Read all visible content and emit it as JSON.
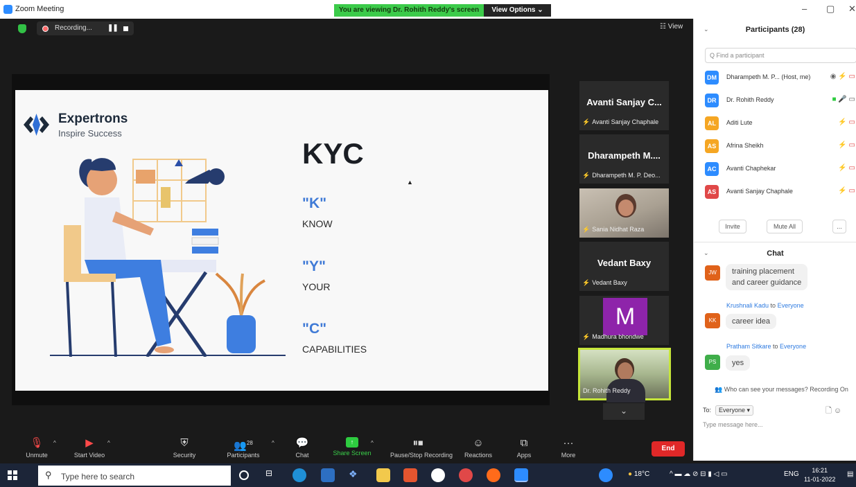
{
  "window": {
    "title": "Zoom Meeting",
    "viewing_banner": "You are viewing Dr. Rohith Reddy's screen",
    "view_options": "View Options ⌄",
    "controls": [
      "–",
      "▢",
      "✕"
    ]
  },
  "recording": {
    "label": "Recording...",
    "pause": "❚❚"
  },
  "view_button": "☷ View",
  "slide": {
    "brand": "Expertrons",
    "tagline": "Inspire Success",
    "heading": "KYC",
    "items": [
      {
        "letter": "\"K\"",
        "word": "KNOW"
      },
      {
        "letter": "\"Y\"",
        "word": "YOUR"
      },
      {
        "letter": "\"C\"",
        "word": "CAPABILITIES"
      }
    ]
  },
  "thumbnails": [
    {
      "type": "name",
      "name": "Avanti Sanjay C...",
      "sub": "Avanti Sanjay Chaphale"
    },
    {
      "type": "name",
      "name": "Dharampeth M....",
      "sub": "Dharampeth M. P. Deo..."
    },
    {
      "type": "video",
      "sub": "Sania Nidhat Raza"
    },
    {
      "type": "name",
      "name": "Vedant Baxy",
      "sub": "Vedant Baxy"
    },
    {
      "type": "avatar",
      "letter": "M",
      "sub": "Madhura bhondwe"
    },
    {
      "type": "video-active",
      "sub": "Dr. Rohith Reddy"
    }
  ],
  "toolbar": {
    "unmute": "Unmute",
    "start_video": "Start Video",
    "security": "Security",
    "participants": "Participants",
    "participants_count": "28",
    "chat": "Chat",
    "share_screen": "Share Screen",
    "pause_recording": "Pause/Stop Recording",
    "reactions": "Reactions",
    "apps": "Apps",
    "more": "More",
    "end": "End"
  },
  "participants_panel": {
    "title": "Participants (28)",
    "search_placeholder": "Q Find a participant",
    "list": [
      {
        "initials": "DM",
        "color": "#2d8cff",
        "name": "Dharampeth M. P... (Host, me)",
        "icons": "◉ 🎤̸ ▭̸"
      },
      {
        "initials": "DR",
        "color": "#2d8cff",
        "name": "Dr. Rohith Reddy",
        "icons": "▣ 🎤 ▭"
      },
      {
        "initials": "AL",
        "color": "#f5a623",
        "name": "Aditi Lute",
        "icons": "🎤̸ ▭̸"
      },
      {
        "initials": "AS",
        "color": "#f5a623",
        "name": "Afrina Sheikh",
        "icons": "🎤̸ ▭̸"
      },
      {
        "initials": "AC",
        "color": "#2d8cff",
        "name": "Avanti Chaphekar",
        "icons": "🎤̸ ▭̸"
      },
      {
        "initials": "AS",
        "color": "#e04848",
        "name": "Avanti Sanjay Chaphale",
        "icons": "🎤̸ ▭̸"
      }
    ],
    "invite": "Invite",
    "mute_all": "Mute All",
    "more": "..."
  },
  "chat": {
    "title": "Chat",
    "messages": [
      {
        "avatar": "JW",
        "avatar_color": "#e0621a",
        "sender": "",
        "to": "",
        "text": "training placement\nand career guidance"
      },
      {
        "avatar": "KK",
        "avatar_color": "#e0621a",
        "sender": "Krushnali Kadu",
        "to": "Everyone",
        "text": "career idea"
      },
      {
        "avatar": "PS",
        "avatar_color": "#3fae4a",
        "sender": "Pratham Sitkare",
        "to": "Everyone",
        "text": "yes"
      }
    ],
    "to_word": " to ",
    "who_can_see": "Who can see your messages? Recording On",
    "to_label": "To:",
    "to_value": "Everyone ▾",
    "input_placeholder": "Type message here..."
  },
  "taskbar": {
    "search_placeholder": "Type here to search",
    "weather": "18°C",
    "lang": "ENG",
    "time": "16:21",
    "date": "11-01-2022"
  }
}
